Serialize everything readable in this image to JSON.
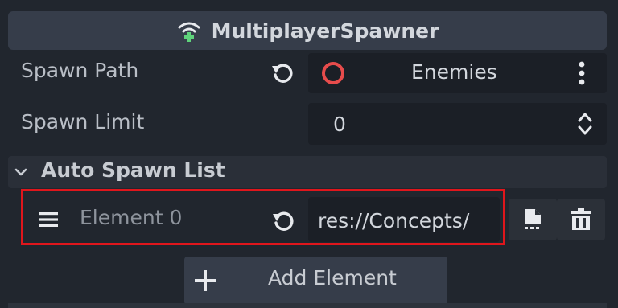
{
  "inspector": {
    "node_type": "MultiplayerSpawner",
    "properties": {
      "spawn_path": {
        "label": "Spawn Path",
        "value": "Enemies"
      },
      "spawn_limit": {
        "label": "Spawn Limit",
        "value": "0"
      }
    },
    "auto_spawn_list": {
      "title": "Auto Spawn List",
      "elements": [
        {
          "label": "Element 0",
          "value": "res://Concepts/"
        }
      ],
      "add_label": "Add Element"
    }
  },
  "icons": {
    "header": "multiplayer-spawner-icon",
    "revert": "revert-icon",
    "node_path": "node-path-icon",
    "menu": "vertical-dots-icon",
    "stepper": "up-down-arrows-icon",
    "collapse": "chevron-down-icon",
    "drag": "drag-handle-icon",
    "file": "file-icon",
    "delete": "trash-icon",
    "add": "plus-icon"
  },
  "colors": {
    "background": "#21262e",
    "header": "#363d4a",
    "field": "#1b1f26",
    "highlight": "#e0161c",
    "node_path_ring": "#e74c4c",
    "spawner_green": "#5fd37b"
  }
}
